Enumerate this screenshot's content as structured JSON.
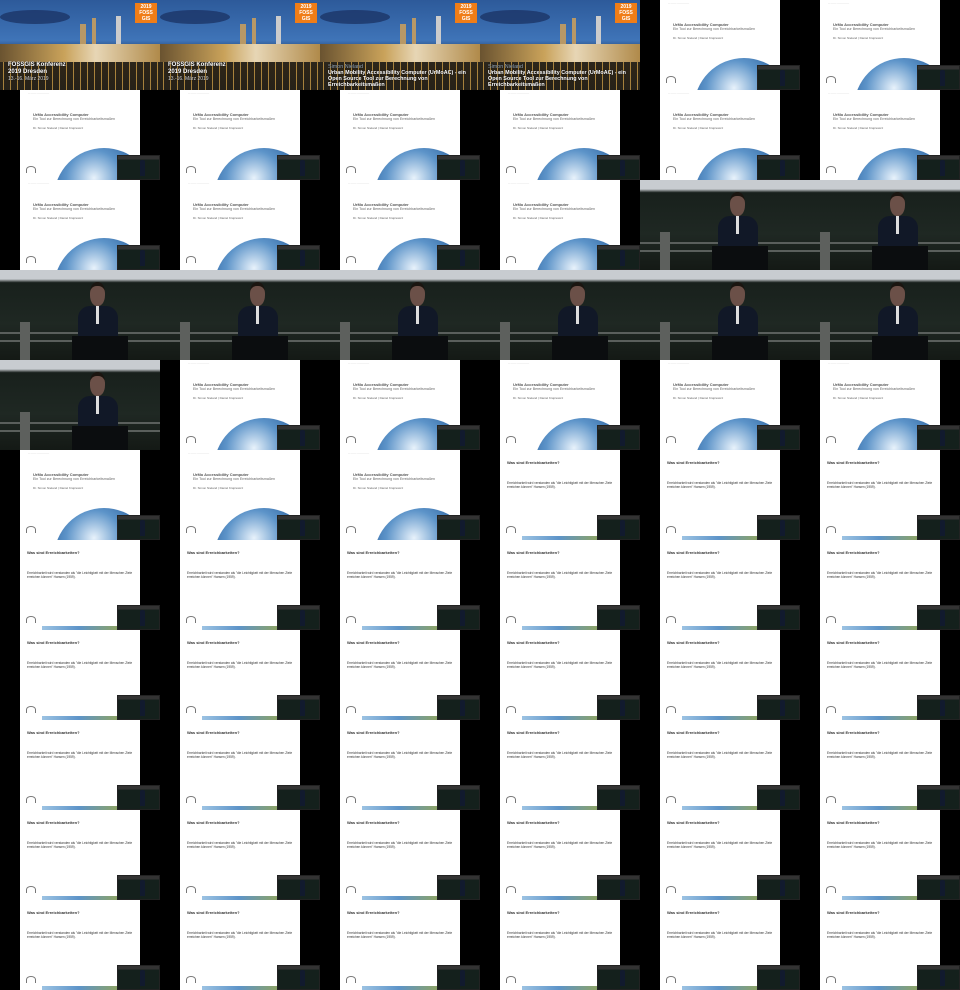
{
  "conference_title": {
    "name": "FOSSGIS Konferenz",
    "year_city": "2019 Dresden",
    "dates": "13.-16. März 2019",
    "logo": "2019 FOSS GIS"
  },
  "talk_title": {
    "author": "Simon Nieland",
    "title": "Urban Mobility Accessibility Computer (UrMoAC) - ein Open Source Tool zur Berechnung von Erreichbarkeitsmaßen",
    "logo": "2019 FOSS GIS"
  },
  "slide_intro": {
    "title": "UrMo Accessibility Computer",
    "subtitle": "Ein Tool zur Berechnung von Erreichbarkeitsmaßen",
    "authors": "Dr. Simon Nieland | Daniel Krajzewicz"
  },
  "slide_definition": {
    "heading": "Was sind Erreichbarkeiten?",
    "body": "Erreichbarkeit wird verstanden als \"die Leichtigkeit mit der Menschen Ziele erreichen können\" Hansen (1959)."
  },
  "frames": [
    "conference",
    "conference",
    "talk",
    "talk",
    "intro",
    "intro",
    "intro",
    "intro",
    "intro",
    "intro",
    "intro",
    "intro",
    "intro",
    "intro",
    "intro",
    "intro",
    "speaker",
    "speaker",
    "speaker",
    "speaker",
    "speaker",
    "speaker",
    "speaker",
    "speaker",
    "speaker",
    "intro",
    "intro",
    "intro",
    "intro",
    "intro",
    "intro",
    "intro",
    "intro",
    "definition",
    "definition",
    "definition",
    "definition",
    "definition",
    "definition",
    "definition",
    "definition",
    "definition",
    "definition",
    "definition",
    "definition",
    "definition",
    "definition",
    "definition",
    "definition",
    "definition",
    "definition",
    "definition",
    "definition",
    "definition",
    "definition",
    "definition",
    "definition",
    "definition",
    "definition",
    "definition",
    "definition",
    "definition",
    "definition",
    "definition",
    "definition",
    "definition"
  ]
}
